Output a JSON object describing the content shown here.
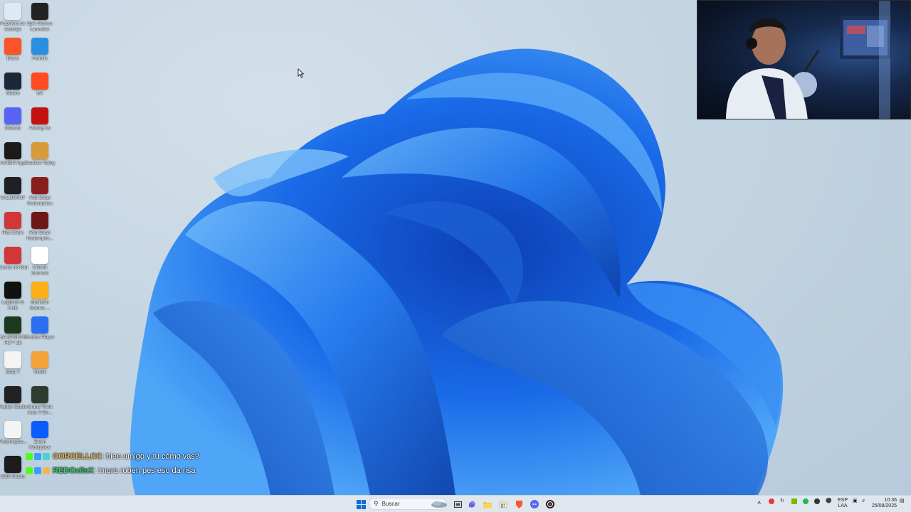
{
  "desktop": {
    "icons_col1": [
      {
        "label": "Papelera de reciclaje",
        "icon": "recycle-bin-icon",
        "color": "#dfe9f4"
      },
      {
        "label": "Brave",
        "icon": "brave-icon",
        "color": "#fb542b"
      },
      {
        "label": "Steam",
        "icon": "steam-icon",
        "color": "#1b2838"
      },
      {
        "label": "Discord",
        "icon": "discord-icon",
        "color": "#5865f2"
      },
      {
        "label": "NVIDIA App",
        "icon": "nvidia-icon",
        "color": "#1a1a1a"
      },
      {
        "label": "VALORANT",
        "icon": "valorant-icon",
        "color": "#1f1f24"
      },
      {
        "label": "Riot Client",
        "icon": "riot-client-icon",
        "color": "#d13639"
      },
      {
        "label": "Cliente de Riot",
        "icon": "riot-client-icon",
        "color": "#d13639"
      },
      {
        "label": "Logitech G HUB",
        "icon": "logitech-icon",
        "color": "#111111"
      },
      {
        "label": "EA SPORTS FC™ 25",
        "icon": "ea-fc-icon",
        "color": "#1e3a1e"
      },
      {
        "label": "Data 7",
        "icon": "document-icon",
        "color": "#f4f4f4"
      },
      {
        "label": "Roblox Studio",
        "icon": "roblox-studio-icon",
        "color": "#222222"
      },
      {
        "label": "Phasmopho...",
        "icon": "document-icon",
        "color": "#f4f4f4"
      },
      {
        "label": "OBS Studio",
        "icon": "obs-icon",
        "color": "#1c1c1c"
      }
    ],
    "icons_col2": [
      {
        "label": "Epic Games Launcher",
        "icon": "epic-games-icon",
        "color": "#222222"
      },
      {
        "label": "Fortnite",
        "icon": "fortnite-icon",
        "color": "#2a8fe0"
      },
      {
        "label": "EA",
        "icon": "ea-icon",
        "color": "#ff4b1f"
      },
      {
        "label": "Among Us",
        "icon": "among-us-icon",
        "color": "#c51111"
      },
      {
        "label": "Stardew Valley",
        "icon": "stardew-valley-icon",
        "color": "#d89a3c"
      },
      {
        "label": "Red Dead Redemption",
        "icon": "red-dead-icon",
        "color": "#8a1e1e"
      },
      {
        "label": "Red Dead Redemptio...",
        "icon": "red-dead-icon",
        "color": "#6e1717"
      },
      {
        "label": "Ubisoft Connect",
        "icon": "ubisoft-icon",
        "color": "#ffffff"
      },
      {
        "label": "Rockstar Games ...",
        "icon": "rockstar-icon",
        "color": "#fcaf17"
      },
      {
        "label": "Roblox Player",
        "icon": "roblox-icon",
        "color": "#2b6ef2"
      },
      {
        "label": "Vinelli",
        "icon": "vinelli-icon",
        "color": "#f2a33a"
      },
      {
        "label": "Grand Theft Auto V En...",
        "icon": "gta-icon",
        "color": "#2e3b2e"
      },
      {
        "label": "Zoom Workplace",
        "icon": "zoom-icon",
        "color": "#0b5cff"
      }
    ]
  },
  "chat": {
    "messages": [
      {
        "user": "CORCELLCC",
        "user_color": "#f2b84b",
        "text": ": bien amigo y tu cómo vas?"
      },
      {
        "user": "REDOxilsX",
        "user_color": "#3ccf6a",
        "text": ": !mura roben pes eso da risa"
      }
    ]
  },
  "taskbar": {
    "search_placeholder": "Buscar",
    "language": "ESP",
    "language_sub": "LAA",
    "time": "10:36",
    "date": "25/08/2025",
    "pinned": [
      {
        "icon": "windows-start-icon"
      },
      {
        "icon": "task-view-icon"
      },
      {
        "icon": "copilot-icon"
      },
      {
        "icon": "file-explorer-icon"
      },
      {
        "icon": "store-icon"
      },
      {
        "icon": "brave-icon"
      },
      {
        "icon": "discord-icon"
      },
      {
        "icon": "obs-icon"
      }
    ]
  },
  "colors": {
    "accent": "#1e6fe0",
    "taskbar_bg": "#dfe6ee"
  }
}
